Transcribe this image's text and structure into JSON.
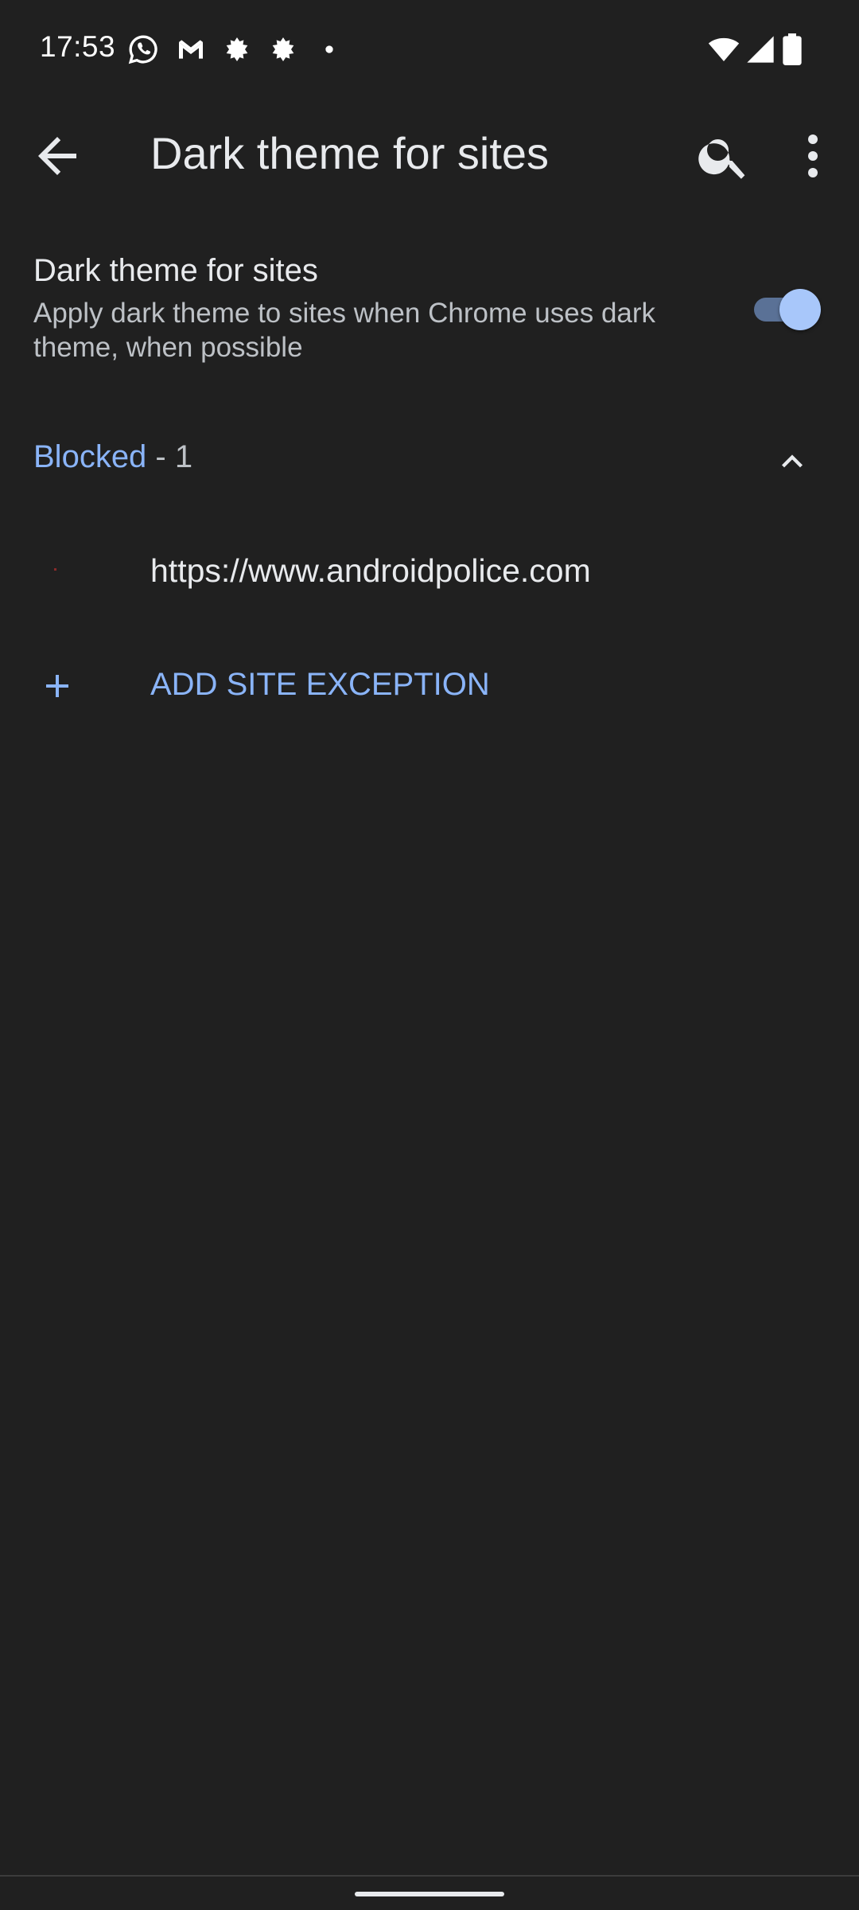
{
  "status_bar": {
    "time": "17:53",
    "left_icons": [
      "whatsapp-icon",
      "gmail-icon",
      "app-leaf-icon",
      "app-leaf-icon",
      "dot-icon"
    ],
    "right_icons": [
      "wifi-icon",
      "signal-icon",
      "battery-icon"
    ]
  },
  "app_bar": {
    "title": "Dark theme for sites",
    "back_icon": "arrow-back-icon",
    "search_icon": "search-icon",
    "more_icon": "more-vert-icon"
  },
  "setting": {
    "title": "Dark theme for sites",
    "summary": "Apply dark theme to sites when Chrome uses dark theme, when possible",
    "enabled": true
  },
  "section": {
    "label": "Blocked",
    "count_text": " - 1",
    "expanded": true
  },
  "sites": [
    {
      "url": "https://www.androidpolice.com"
    }
  ],
  "add_exception": {
    "label": "ADD SITE EXCEPTION"
  },
  "colors": {
    "background": "#202020",
    "accent": "#8ab4f8",
    "primary_text": "#e8eaed",
    "secondary_text": "#bdc1c6"
  }
}
